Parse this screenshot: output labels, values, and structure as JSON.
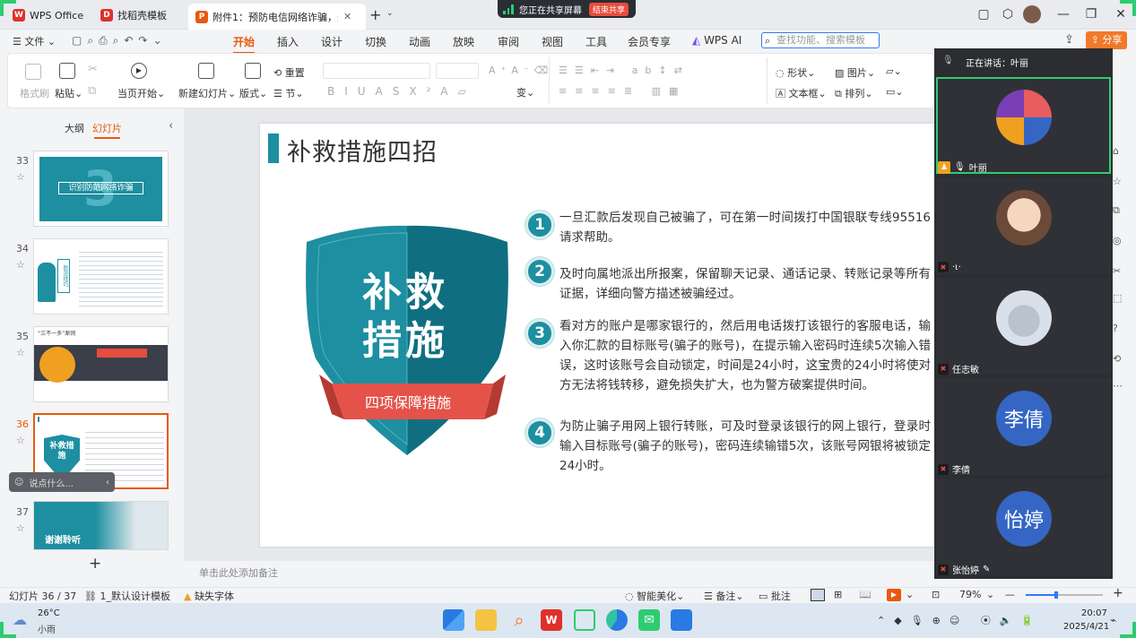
{
  "tabs": [
    {
      "label": "WPS Office"
    },
    {
      "label": "找稻壳模板"
    },
    {
      "label": "附件1：预防电信网络诈骗，未"
    }
  ],
  "share_bar": {
    "status": "您正在共享屏幕",
    "end": "结束共享"
  },
  "menu": {
    "file": "文件",
    "items": [
      "开始",
      "插入",
      "设计",
      "切换",
      "动画",
      "放映",
      "审阅",
      "视图",
      "工具",
      "会员专享",
      "WPS AI"
    ],
    "active": "开始",
    "search_placeholder": "查找功能、搜索模板",
    "share": "分享"
  },
  "ribbon": {
    "format_brush": "格式刷",
    "paste": "粘贴",
    "from_current": "当页开始",
    "new_slide": "新建幻灯片",
    "layout": "版式",
    "section": "节",
    "reset": "重置",
    "shape": "形状",
    "textbox": "文本框",
    "picture": "图片",
    "arrange": "排列"
  },
  "left_panel": {
    "tab_outline": "大纲",
    "tab_slides": "幻灯片",
    "slides": [
      {
        "num": "33",
        "thumb_text": "识别防范网络诈骗"
      },
      {
        "num": "34",
        "thumb_text": "防范技巧"
      },
      {
        "num": "35",
        "thumb_text": "“三不一多”原则"
      },
      {
        "num": "36",
        "thumb_text": "补救措施"
      },
      {
        "num": "37",
        "thumb_text": "谢谢聆听"
      }
    ],
    "current": "36",
    "say_placeholder": "说点什么...",
    "add": "+"
  },
  "slide": {
    "title": "补救措施四招",
    "shield_line1": "补救",
    "shield_line2": "措施",
    "shield_ribbon": "四项保障措施",
    "points": [
      {
        "n": "1",
        "text": "一旦汇款后发现自己被骗了，可在第一时间拨打中国银联专线95516请求帮助。"
      },
      {
        "n": "2",
        "text": "及时向属地派出所报案，保留聊天记录、通话记录、转账记录等所有证据，详细向警方描述被骗经过。"
      },
      {
        "n": "3",
        "text": "看对方的账户是哪家银行的，然后用电话拨打该银行的客服电话，输入你汇款的目标账号(骗子的账号)，在提示输入密码时连续5次输入错误，这时该账号会自动锁定，时间是24小时，这宝贵的24小时将使对方无法将钱转移，避免损失扩大，也为警方破案提供时间。"
      },
      {
        "n": "4",
        "text": "为防止骗子用网上银行转账，可及时登录该银行的网上银行，登录时输入目标账号(骗子的账号)，密码连续输错5次，该账号网银将被锁定24小时。"
      }
    ],
    "notes_placeholder": "单击此处添加备注"
  },
  "meeting": {
    "speaking_label": "正在讲话：",
    "speaking_name": "叶丽",
    "participants": [
      {
        "name": "叶丽",
        "avatar": "photo"
      },
      {
        "name": "·ι·",
        "avatar": "photo"
      },
      {
        "name": "任志敏",
        "avatar": "photo"
      },
      {
        "name": "李倩",
        "avatar": "李倩"
      },
      {
        "name": "张怡婷",
        "avatar": "怡婷"
      }
    ]
  },
  "status_bar": {
    "slide_pos": "幻灯片 36 / 37",
    "template": "1_默认设计模板",
    "missing_font": "缺失字体",
    "beautify": "智能美化",
    "notes": "备注",
    "comment": "批注",
    "zoom": "79%",
    "zoom_fraction": 0.4
  },
  "taskbar": {
    "weather_temp": "26°C",
    "weather_desc": "小雨",
    "time": "20:07",
    "date": "2025/4/21"
  },
  "colors": {
    "accent": "#e8590c",
    "teal": "#1d8fa0",
    "speaking": "#2ecc71"
  }
}
